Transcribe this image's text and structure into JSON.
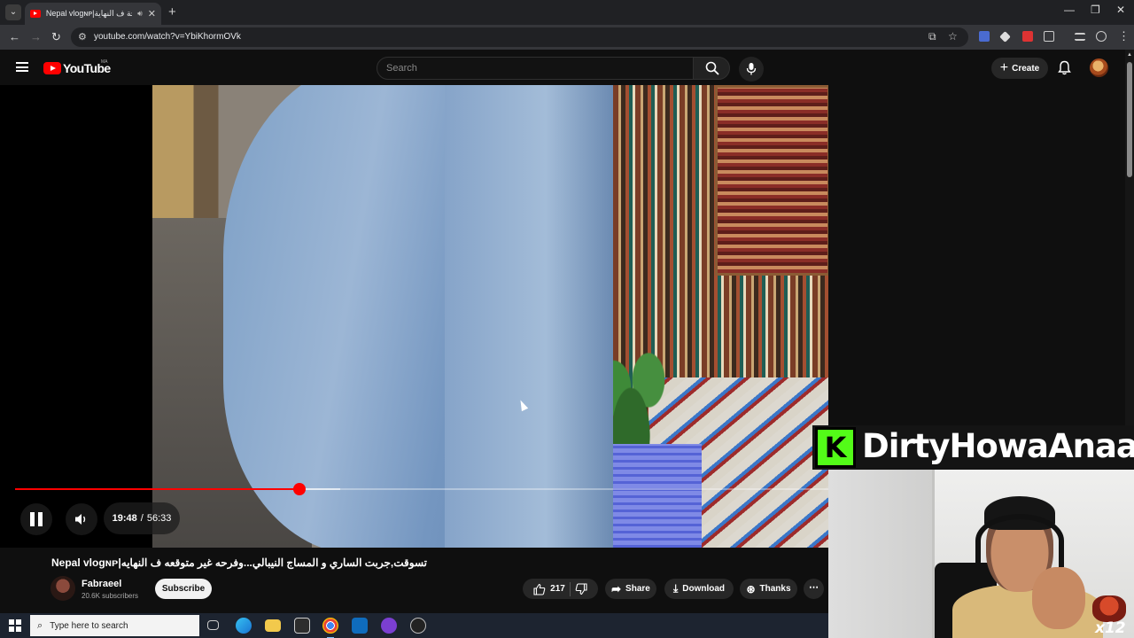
{
  "browser": {
    "tab_title": "Nepal vlogɴᴘ|تسوقت,جربت الساري و المساج النيبالي...وفرحه غير متوقعه ف النهايه",
    "tab_title_display": "Nepal vlogɴᴘ|نحة ف النهاية",
    "url": "youtube.com/watch?v=YbiKhormOVk"
  },
  "youtube": {
    "brand": "YouTube",
    "country_code": "MA",
    "search_placeholder": "Search",
    "create_label": "Create"
  },
  "player": {
    "current_time": "19:48",
    "duration": "56:33",
    "time_separator": "/",
    "played_fraction": 0.35,
    "buffered_fraction": 0.4,
    "state": "playing"
  },
  "overlay": {
    "platform_letter": "K",
    "streamer_name": "DirtyHowaAnaa",
    "multiplier": "x12",
    "accent_color": "#53fc18"
  },
  "video": {
    "title": "Nepal vlogɴᴘ|تسوقت,جربت الساري و المساج النيبالي...وفرحه غير متوقعه ف النهايه",
    "channel": "Fabraeel",
    "subscribers": "20.6K subscribers",
    "subscribe_label": "Subscribe",
    "likes": "217",
    "share_label": "Share",
    "download_label": "Download",
    "thanks_label": "Thanks"
  },
  "taskbar": {
    "search_placeholder": "Type here to search"
  },
  "colors": {
    "youtube_red": "#ff0000",
    "background": "#0f0f0f"
  }
}
